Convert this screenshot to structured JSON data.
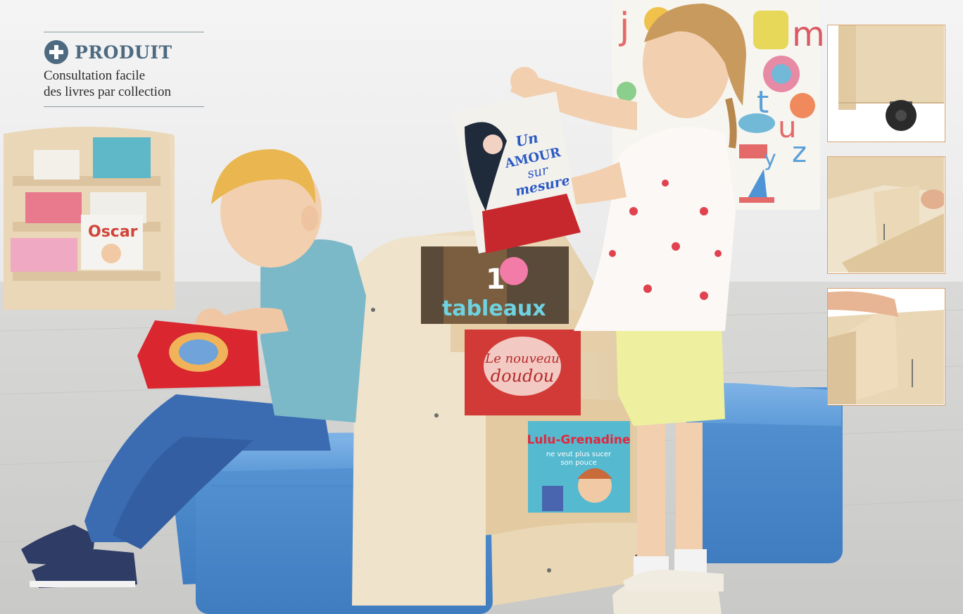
{
  "badge": {
    "title": "PRODUIT",
    "description_line1": "Consultation facile",
    "description_line2": "des livres par collection",
    "icon": "plus-circle-icon",
    "title_color": "#4d6a80"
  },
  "books": {
    "back_shelf": [
      "Oscar"
    ],
    "girl_book_line1": "Un",
    "girl_book_line2": "AMOUR",
    "girl_book_line3": "sur",
    "girl_book_line4": "mesure",
    "display_top_number": "1",
    "display_top": "tableaux",
    "display_middle_line1": "Le nouveau",
    "display_middle_line2": "doudou",
    "display_bottom_line1": "Lulu-Grenadine",
    "display_bottom_line2": "ne veut plus sucer",
    "display_bottom_line3": "son pouce"
  },
  "colors": {
    "pouf_blue": "#5a9ad8",
    "wood": "#e8d4b4",
    "thumb_border": "#d7a36e"
  }
}
